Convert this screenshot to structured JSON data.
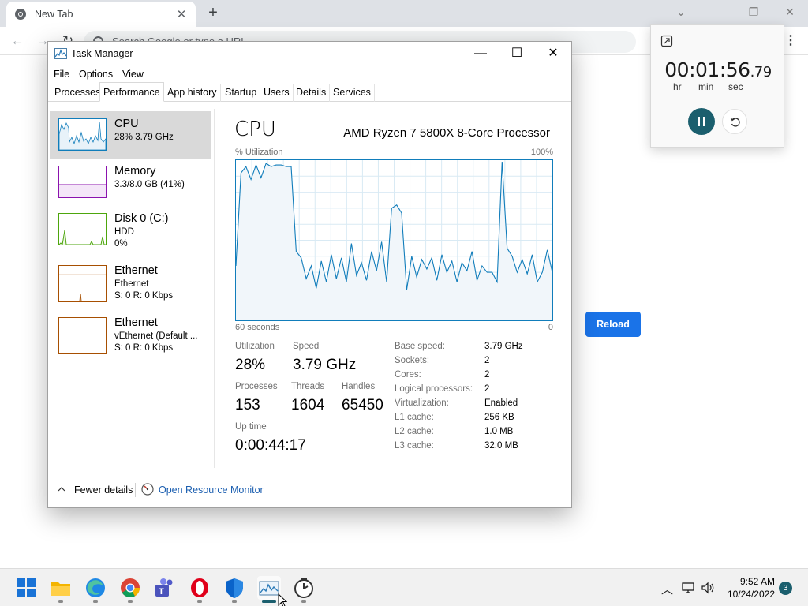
{
  "browser": {
    "tab_title": "New Tab",
    "omnibox_placeholder": "Search Google or type a URL",
    "reload_label": "Reload"
  },
  "clock_widget": {
    "time_main": "00:01:56",
    "time_fraction": ".79",
    "units": [
      "hr",
      "min",
      "sec"
    ]
  },
  "task_manager": {
    "title": "Task Manager",
    "menus": [
      "File",
      "Options",
      "View"
    ],
    "tabs": [
      "Processes",
      "Performance",
      "App history",
      "Startup",
      "Users",
      "Details",
      "Services"
    ],
    "active_tab": "Performance",
    "resources": [
      {
        "name": "CPU",
        "line1": "28%  3.79 GHz",
        "line2": "",
        "color": "#117dbb",
        "selected": true
      },
      {
        "name": "Memory",
        "line1": "3.3/8.0 GB (41%)",
        "line2": "",
        "color": "#8b12ae",
        "selected": false
      },
      {
        "name": "Disk 0 (C:)",
        "line1": "HDD",
        "line2": "0%",
        "color": "#4da60c",
        "selected": false
      },
      {
        "name": "Ethernet",
        "line1": "Ethernet",
        "line2": "S: 0  R: 0 Kbps",
        "color": "#a74f01",
        "selected": false
      },
      {
        "name": "Ethernet",
        "line1": "vEthernet (Default ...",
        "line2": "S: 0  R: 0 Kbps",
        "color": "#a74f01",
        "selected": false
      }
    ],
    "cpu_panel": {
      "title": "CPU",
      "model": "AMD Ryzen 7 5800X 8-Core Processor",
      "graph_label": "% Utilization",
      "graph_max": "100%",
      "graph_time": "60 seconds",
      "graph_min": "0",
      "utilization_series": [
        34,
        92,
        96,
        88,
        97,
        89,
        98,
        96,
        97,
        97,
        96,
        96,
        43,
        39,
        26,
        34,
        20,
        37,
        24,
        41,
        26,
        39,
        24,
        48,
        28,
        36,
        25,
        43,
        31,
        49,
        24,
        70,
        72,
        67,
        19,
        40,
        27,
        38,
        32,
        39,
        25,
        41,
        30,
        37,
        24,
        36,
        31,
        43,
        25,
        34,
        30,
        30,
        24,
        99,
        45,
        40,
        30,
        38,
        29,
        41,
        24,
        30,
        44,
        30
      ],
      "stats": {
        "utilization_label": "Utilization",
        "utilization": "28%",
        "speed_label": "Speed",
        "speed": "3.79 GHz",
        "processes_label": "Processes",
        "processes": "153",
        "threads_label": "Threads",
        "threads": "1604",
        "handles_label": "Handles",
        "handles": "65450",
        "uptime_label": "Up time",
        "uptime": "0:00:44:17"
      },
      "specs": [
        {
          "label": "Base speed:",
          "value": "3.79 GHz"
        },
        {
          "label": "Sockets:",
          "value": "2"
        },
        {
          "label": "Cores:",
          "value": "2"
        },
        {
          "label": "Logical processors:",
          "value": "2"
        },
        {
          "label": "Virtualization:",
          "value": "Enabled"
        },
        {
          "label": "L1 cache:",
          "value": "256 KB"
        },
        {
          "label": "L2 cache:",
          "value": "1.0 MB"
        },
        {
          "label": "L3 cache:",
          "value": "32.0 MB"
        }
      ]
    },
    "footer": {
      "fewer_details": "Fewer details",
      "open_resource_monitor": "Open Resource Monitor"
    }
  },
  "taskbar": {
    "apps": [
      "start-icon",
      "file-explorer-icon",
      "edge-icon",
      "chrome-icon",
      "teams-icon",
      "opera-icon",
      "defender-icon",
      "task-manager-icon",
      "clock-icon"
    ],
    "time": "9:52 AM",
    "date": "10/24/2022",
    "notification_count": "3"
  }
}
